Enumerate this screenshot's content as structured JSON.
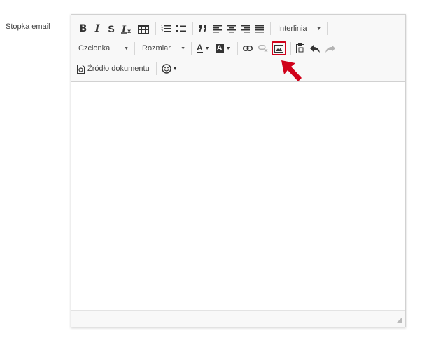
{
  "field": {
    "label": "Stopka email"
  },
  "toolbar": {
    "bold": "B",
    "italic": "I",
    "strike": "S",
    "line_height": "Interlinia",
    "font": "Czcionka",
    "size": "Rozmiar",
    "text_color": "A",
    "bg_color": "A",
    "source": "Źródło dokumentu"
  },
  "colors": {
    "highlight": "#d0021b",
    "toolbar_bg": "#f8f8f8",
    "border": "#d1d1d1"
  },
  "icons": [
    "remove-format-icon",
    "table-icon",
    "numbered-list-icon",
    "bulleted-list-icon",
    "blockquote-icon",
    "align-left-icon",
    "align-center-icon",
    "align-right-icon",
    "align-justify-icon",
    "link-icon",
    "unlink-icon",
    "image-icon",
    "paste-icon",
    "undo-icon",
    "redo-icon",
    "source-icon",
    "emoji-icon"
  ]
}
